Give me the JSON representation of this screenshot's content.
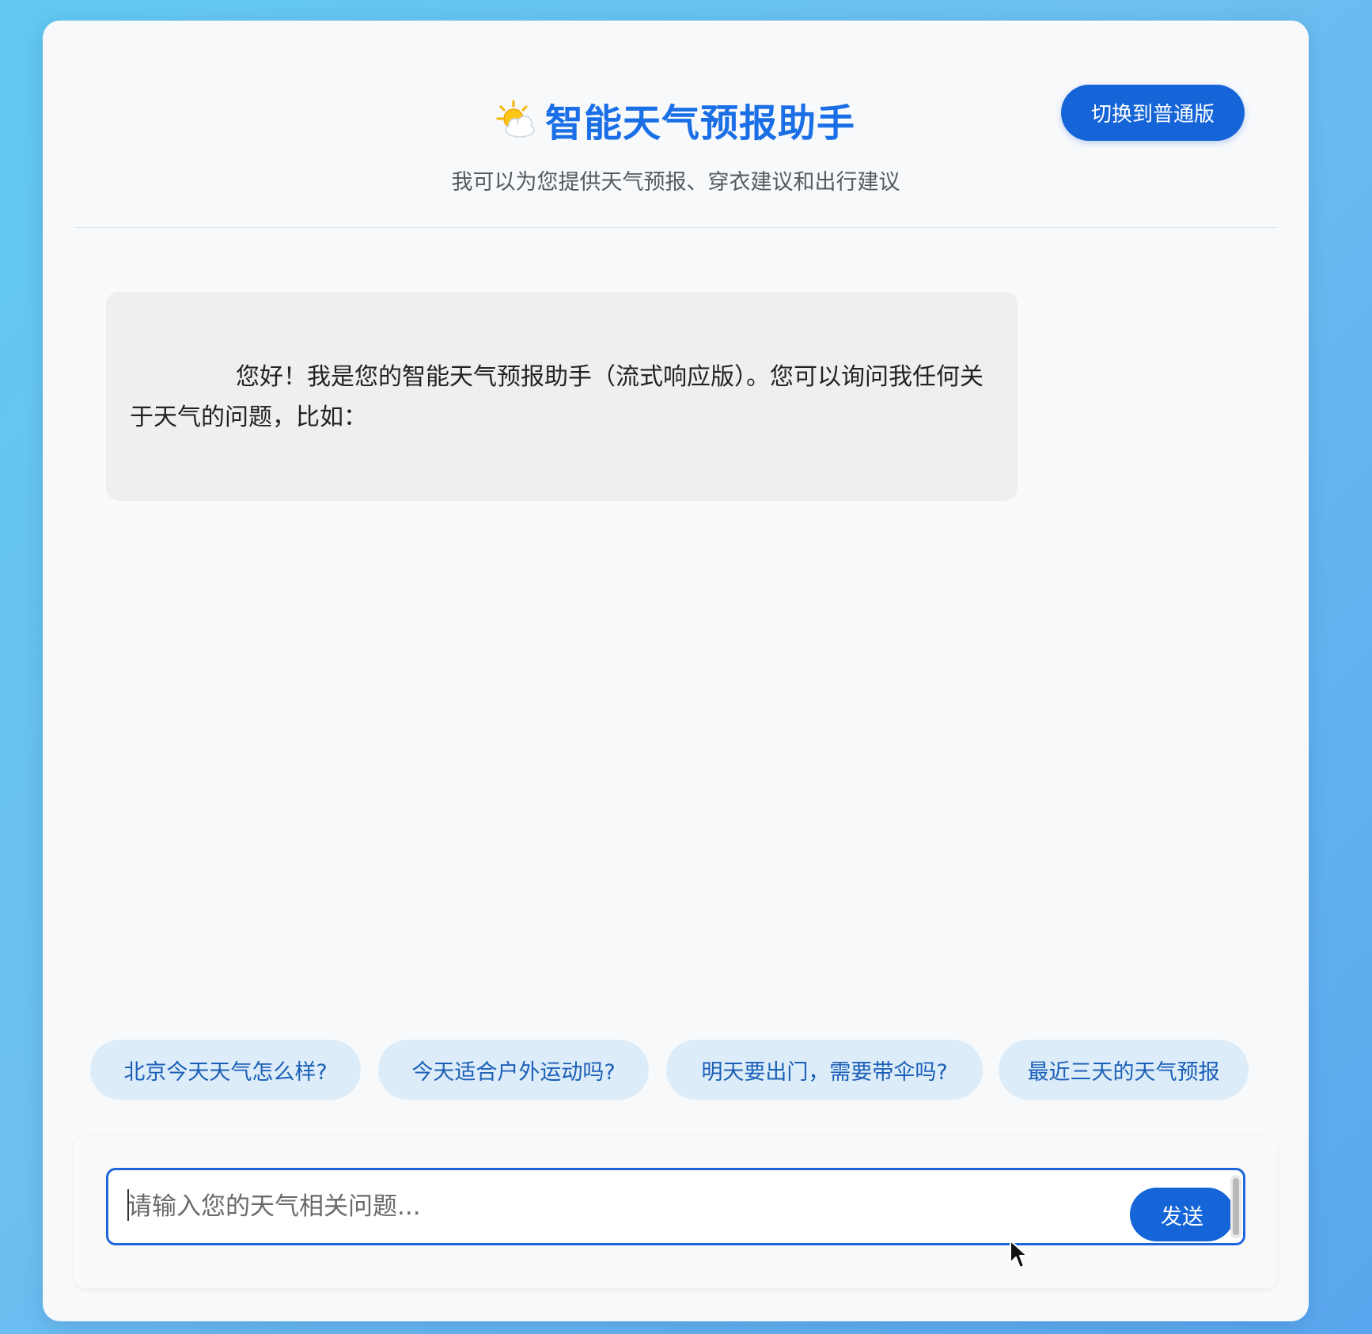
{
  "header": {
    "title": "智能天气预报助手",
    "title_icon": "sun-behind-cloud-icon",
    "subtitle": "我可以为您提供天气预报、穿衣建议和出行建议",
    "switch_button_label": "切换到普通版"
  },
  "chat": {
    "messages": [
      {
        "role": "assistant",
        "text": "您好！我是您的智能天气预报助手（流式响应版）。您可以询问我任何关于天气的问题，比如："
      }
    ]
  },
  "suggestions": [
    "北京今天天气怎么样?",
    "今天适合户外运动吗?",
    "明天要出门，需要带伞吗?",
    "最近三天的天气预报"
  ],
  "input": {
    "value": "",
    "placeholder": "请输入您的天气相关问题...",
    "send_label": "发送"
  },
  "colors": {
    "accent": "#1565d8",
    "title": "#1a6ee6",
    "chip_bg": "#dcecf8",
    "chip_text": "#1b5fb8",
    "background_gradient_start": "#62c8f2",
    "background_gradient_end": "#5aa6ee"
  }
}
